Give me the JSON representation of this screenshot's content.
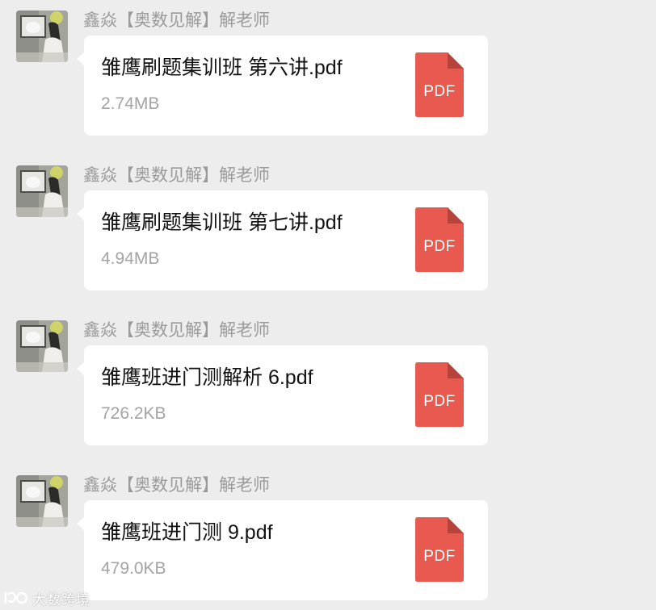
{
  "messages": [
    {
      "sender": "鑫焱【奥数见解】解老师",
      "file_name": "雏鹰刷题集训班 第六讲.pdf",
      "file_size": "2.74MB",
      "file_type": "PDF"
    },
    {
      "sender": "鑫焱【奥数见解】解老师",
      "file_name": "雏鹰刷题集训班 第七讲.pdf",
      "file_size": "4.94MB",
      "file_type": "PDF"
    },
    {
      "sender": "鑫焱【奥数见解】解老师",
      "file_name": "雏鹰班进门测解析 6.pdf",
      "file_size": "726.2KB",
      "file_type": "PDF"
    },
    {
      "sender": "鑫焱【奥数见解】解老师",
      "file_name": "雏鹰班进门测 9.pdf",
      "file_size": "479.0KB",
      "file_type": "PDF"
    }
  ],
  "watermark": {
    "text": "大数跨境",
    "icon": "logo-icon"
  },
  "colors": {
    "background": "#ededed",
    "bubble": "#ffffff",
    "pdf_icon": "#e8594f",
    "pdf_icon_fold": "#b8433b",
    "sender_text": "#9a9a9a",
    "size_text": "#a3a3a3"
  }
}
